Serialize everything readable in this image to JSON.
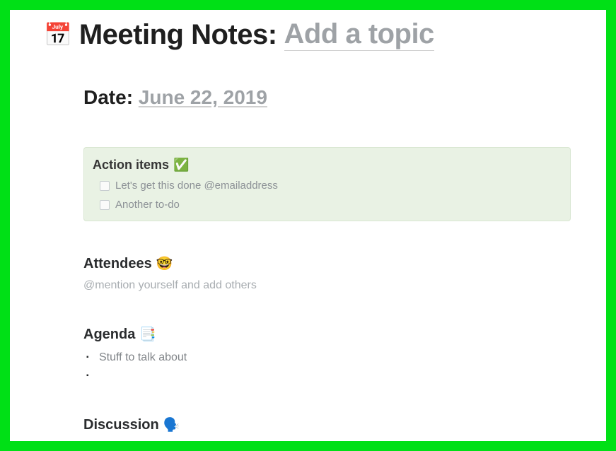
{
  "title": {
    "icon": "📅",
    "label": "Meeting Notes:",
    "placeholder": "Add a topic"
  },
  "date": {
    "label": "Date:",
    "value": "June 22, 2019"
  },
  "action_items": {
    "heading": "Action items",
    "icon": "✅",
    "todos": [
      "Let's get this done @emailaddress",
      "Another to-do"
    ]
  },
  "attendees": {
    "heading": "Attendees",
    "icon": "🤓",
    "placeholder": "@mention yourself and add others"
  },
  "agenda": {
    "heading": "Agenda",
    "icon": "📑",
    "items": [
      "Stuff to talk about",
      ""
    ]
  },
  "discussion": {
    "heading": "Discussion",
    "icon": "🗣️"
  }
}
